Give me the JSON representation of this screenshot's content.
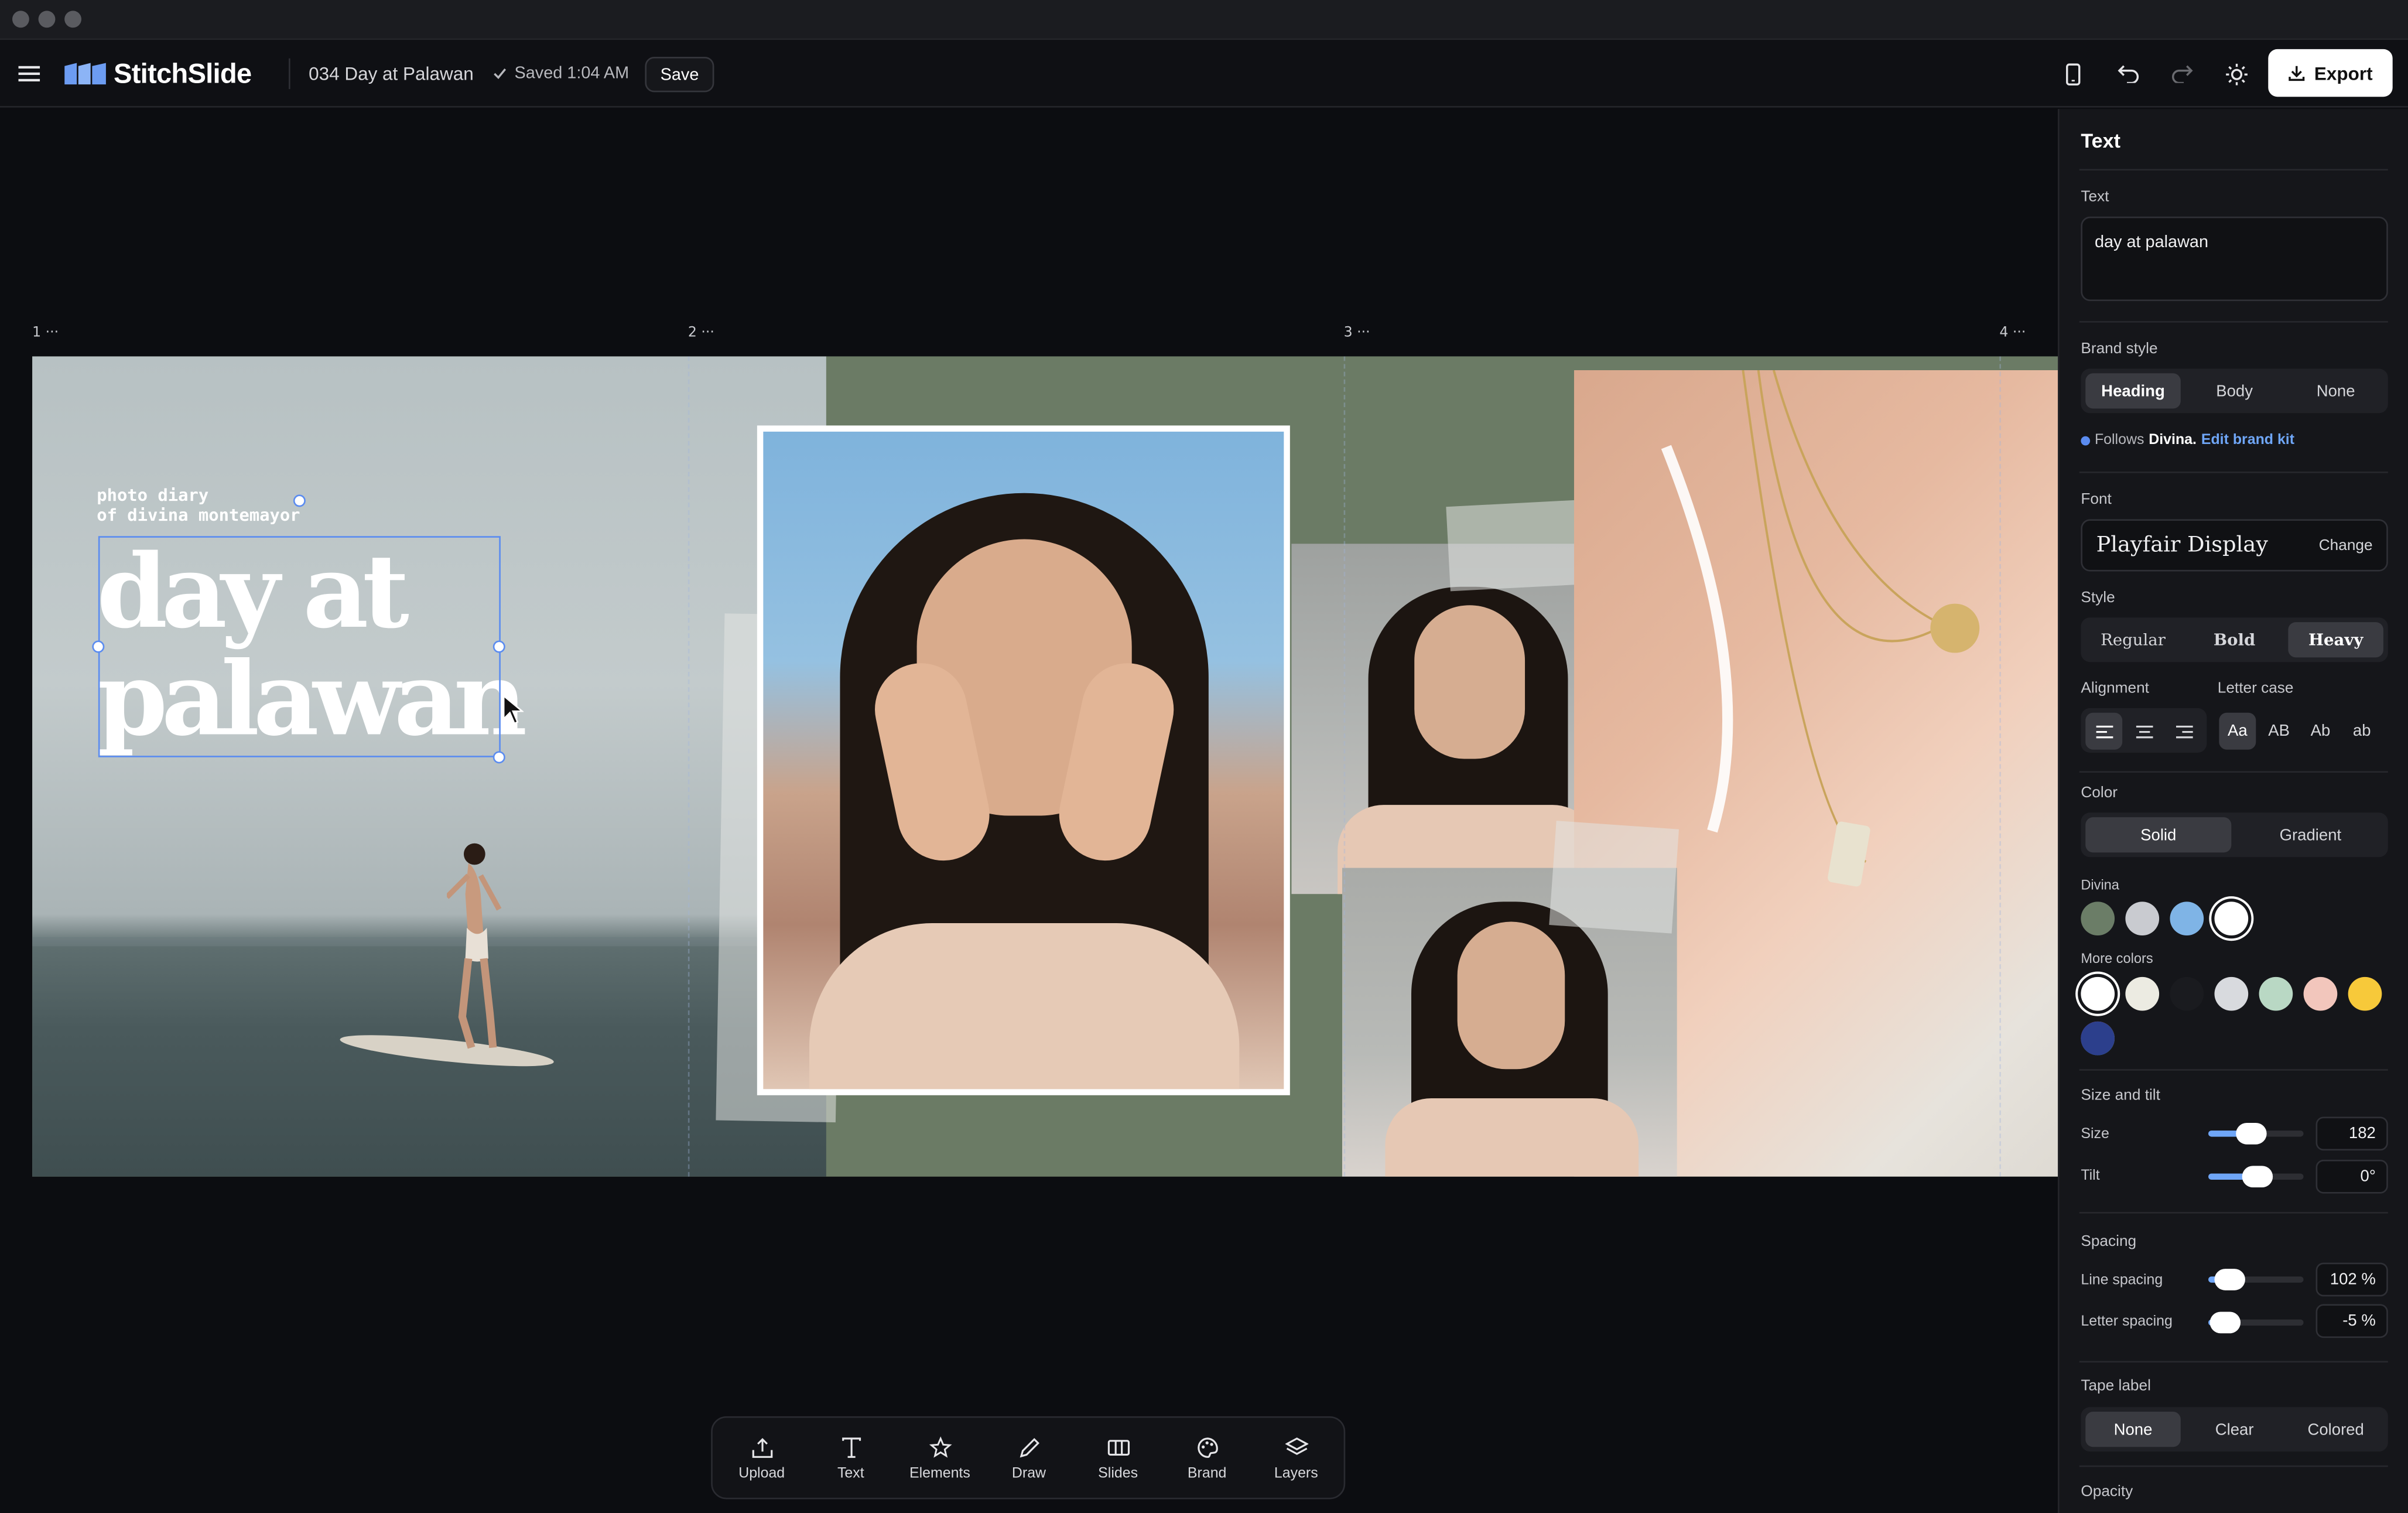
{
  "app": {
    "brand": "StitchSlide",
    "doc_title": "034 Day at Palawan",
    "saved": "Saved 1:04 AM",
    "save_label": "Save",
    "export_label": "Export"
  },
  "canvas": {
    "pages": [
      "1 ···",
      "2 ···",
      "3 ···",
      "4 ···"
    ],
    "caption": "photo diary\nof divina montemayor",
    "headline": "day at palawan"
  },
  "dock": [
    {
      "icon": "upload-icon",
      "label": "Upload"
    },
    {
      "icon": "text-icon",
      "label": "Text"
    },
    {
      "icon": "star-icon",
      "label": "Elements"
    },
    {
      "icon": "pencil-icon",
      "label": "Draw"
    },
    {
      "icon": "columns-icon",
      "label": "Slides"
    },
    {
      "icon": "palette-icon",
      "label": "Brand"
    },
    {
      "icon": "layers-icon",
      "label": "Layers"
    }
  ],
  "panel": {
    "title": "Text",
    "text_label": "Text",
    "text_value": "day at palawan",
    "brand_style_label": "Brand style",
    "brand_style_options": [
      "Heading",
      "Body",
      "None"
    ],
    "brand_style_selected": "Heading",
    "follows_prefix": "Follows",
    "follows_name": "Divina.",
    "edit_brand_kit": "Edit brand kit",
    "font_label": "Font",
    "font_name": "Playfair Display",
    "font_change": "Change",
    "style_label": "Style",
    "style_options": [
      "Regular",
      "Bold",
      "Heavy"
    ],
    "style_selected": "Heavy",
    "alignment_label": "Alignment",
    "letter_case_label": "Letter case",
    "letter_case_options": [
      "Aa",
      "AB",
      "Ab",
      "ab"
    ],
    "letter_case_selected": "Aa",
    "color_label": "Color",
    "color_modes": [
      "Solid",
      "Gradient"
    ],
    "color_mode_selected": "Solid",
    "brand_palette_label": "Divina",
    "brand_colors": [
      "#6b7d67",
      "#c9cbd0",
      "#7fb4e6",
      "#ffffff"
    ],
    "more_colors_label": "More colors",
    "more_colors": [
      "#ffffff",
      "#ecebe2",
      "#1a1b1f",
      "#d8dade",
      "#b9d8c4",
      "#f2c6bc",
      "#f7c93a",
      "#2c3f8c"
    ],
    "size_tilt_label": "Size and tilt",
    "size_label": "Size",
    "size_value": "182",
    "size_level": 0.45,
    "tilt_label": "Tilt",
    "tilt_value": "0°",
    "tilt_level": 0.52,
    "spacing_label": "Spacing",
    "line_spacing_label": "Line spacing",
    "line_spacing_value": "102 %",
    "line_spacing_level": 0.22,
    "letter_spacing_label": "Letter spacing",
    "letter_spacing_value": "-5 %",
    "letter_spacing_level": 0.18,
    "tape_label": "Tape label",
    "tape_options": [
      "None",
      "Clear",
      "Colored"
    ],
    "tape_selected": "None",
    "opacity_label": "Opacity"
  },
  "colors": {
    "accent": "#5b8cf0",
    "slider": "#6fa6f7",
    "canvas_green": "#6b7b65"
  }
}
